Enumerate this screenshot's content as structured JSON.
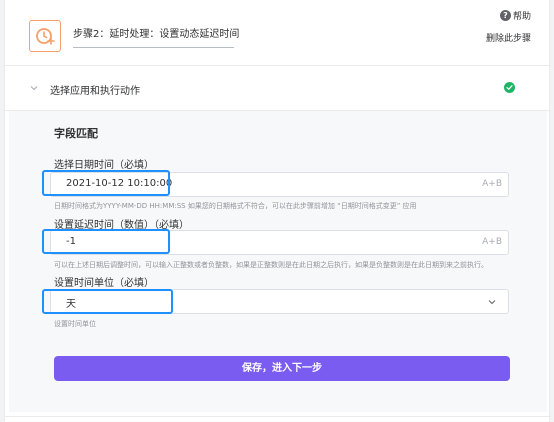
{
  "header": {
    "step_title": "步骤2：延时处理：设置动态延迟时间",
    "help_icon": "question-circle-icon",
    "help_label": "帮助",
    "delete_label": "删除此步骤"
  },
  "section": {
    "label": "选择应用和执行动作",
    "status": "completed"
  },
  "form": {
    "heading": "字段匹配",
    "datetime": {
      "label": "选择日期时间（必填）",
      "value": "2021-10-12 10:10:00",
      "suffix": "A+B",
      "hint": "日期时间格式为YYYY-MM-DD HH:MM:SS 如果您的日期格式不符合，可以在此步骤前增加 “日期时间格式变更” 应用"
    },
    "delay": {
      "label": "设置延迟时间（数值）（必填）",
      "value": "-1",
      "suffix": "A+B",
      "hint": "可以在上述日期后调整时间，可以输入正整数或者负整数，如果是正整数则是在此日期之后执行，如果是负整数则是在此日期到来之前执行。"
    },
    "unit": {
      "label": "设置时间单位（必填）",
      "value": "天",
      "hint": "设置时间单位"
    },
    "submit_label": "保存，进入下一步"
  },
  "colors": {
    "primary": "#7a5cf0",
    "highlight": "#1e90ff",
    "success": "#20b466",
    "step_icon": "#f5a06b"
  }
}
